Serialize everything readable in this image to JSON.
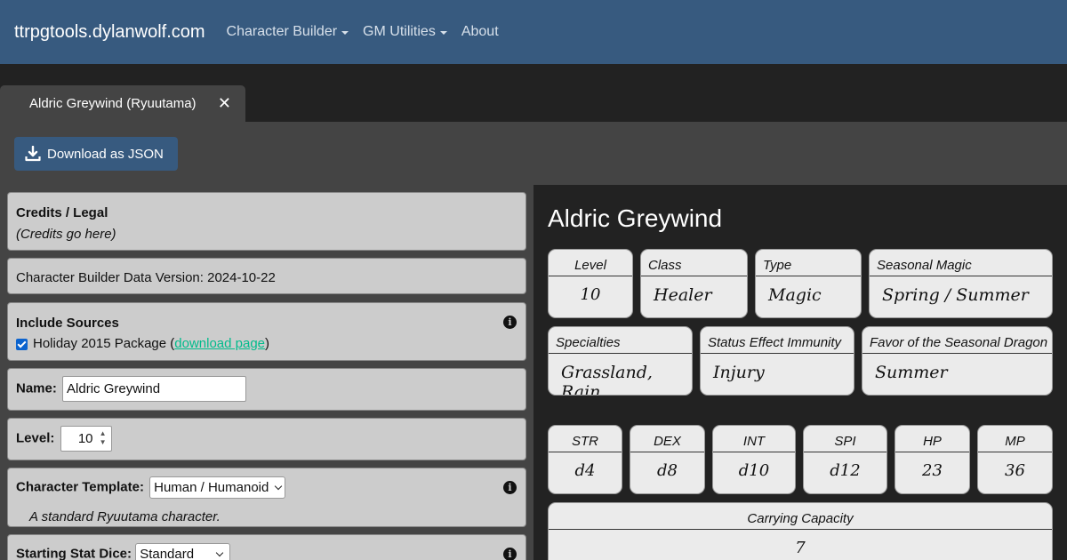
{
  "navbar": {
    "brand": "ttrpgtools.dylanwolf.com",
    "items": [
      {
        "label": "Character Builder",
        "dropdown": true
      },
      {
        "label": "GM Utilities",
        "dropdown": true
      },
      {
        "label": "About",
        "dropdown": false
      }
    ]
  },
  "tab": {
    "label": "Aldric Greywind (Ryuutama)",
    "close": "✕"
  },
  "toolbar": {
    "download_label": "Download as JSON"
  },
  "credits": {
    "title": "Credits / Legal",
    "text": "(Credits go here)"
  },
  "data_version": "Character Builder Data Version: 2024-10-22",
  "sources": {
    "title": "Include Sources",
    "item_prefix": "Holiday 2015 Package (",
    "item_link": "download page",
    "item_suffix": ")"
  },
  "name_field": {
    "label": "Name:",
    "value": "Aldric Greywind"
  },
  "level_field": {
    "label": "Level:",
    "value": "10"
  },
  "template_field": {
    "label": "Character Template:",
    "value": "Human / Humanoid",
    "description": "A standard Ryuutama character."
  },
  "stat_dice_field": {
    "label": "Starting Stat Dice:",
    "value": "Standard"
  },
  "sheet": {
    "name": "Aldric Greywind",
    "row1": [
      {
        "label": "Level",
        "value": "10"
      },
      {
        "label": "Class",
        "value": "Healer"
      },
      {
        "label": "Type",
        "value": "Magic"
      },
      {
        "label": "Seasonal Magic",
        "value": "Spring / Summer"
      }
    ],
    "row2": [
      {
        "label": "Specialties",
        "value": "Grassland, Rain"
      },
      {
        "label": "Status Effect Immunity",
        "value": "Injury"
      },
      {
        "label": "Favor of the Seasonal Dragon",
        "value": "Summer"
      }
    ],
    "stats": [
      {
        "label": "STR",
        "value": "d4"
      },
      {
        "label": "DEX",
        "value": "d8"
      },
      {
        "label": "INT",
        "value": "d10"
      },
      {
        "label": "SPI",
        "value": "d12"
      },
      {
        "label": "HP",
        "value": "23"
      },
      {
        "label": "MP",
        "value": "36"
      }
    ],
    "carrying": {
      "label": "Carrying Capacity",
      "value": "7"
    }
  },
  "colors": {
    "navbar": "#375a7f",
    "link": "#00bc8c",
    "panel_dark": "#222222",
    "card": "#cccccc"
  }
}
